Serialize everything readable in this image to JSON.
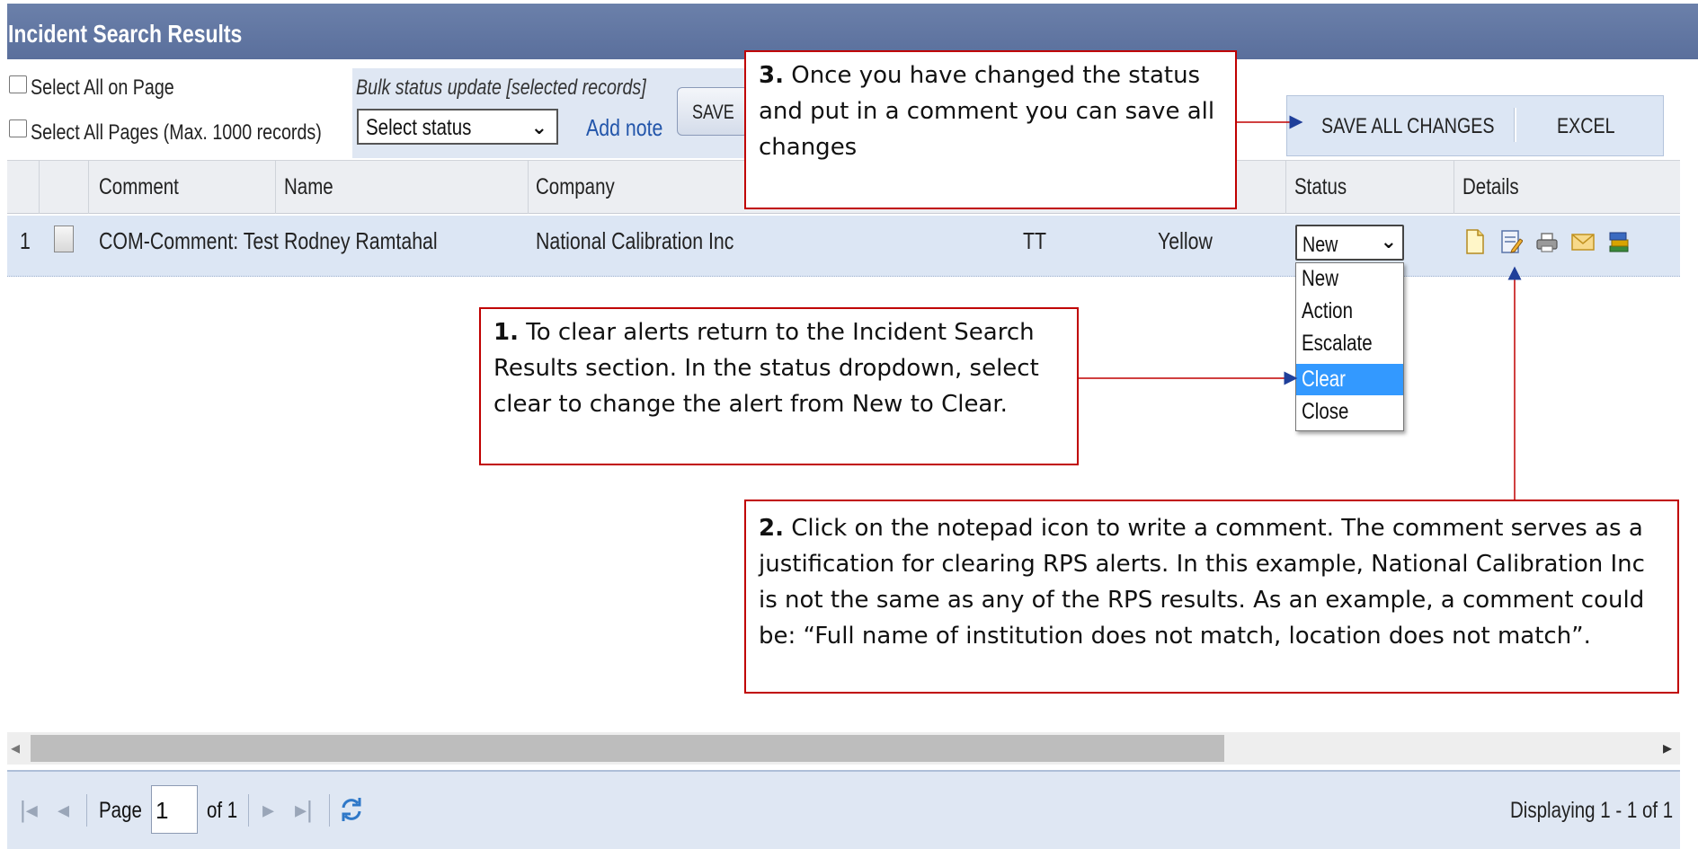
{
  "panel": {
    "title": "Incident Search Results"
  },
  "toolbar": {
    "select_all_page": "Select All on Page",
    "select_all_pages": "Select All Pages (Max. 1000 records)",
    "bulk_label": "Bulk status update [selected records]",
    "status_placeholder": "Select status",
    "add_note": "Add note",
    "save": "SAVE",
    "save_all": "SAVE ALL CHANGES",
    "excel": "EXCEL"
  },
  "grid": {
    "headers": [
      "Comment",
      "Name",
      "Company",
      "Status",
      "Details"
    ],
    "rows": [
      {
        "index": "1",
        "comment": "COM-Comment: Test",
        "name": "Rodney Ramtahal",
        "company": "National Calibration Inc",
        "country": "TT",
        "risk": "Yellow",
        "status": "New"
      }
    ]
  },
  "status_dropdown": {
    "options": [
      "New",
      "Action",
      "Escalate",
      "Clear",
      "Close"
    ],
    "highlighted": "Clear"
  },
  "details_icons": [
    "document-icon",
    "notepad-icon",
    "print-icon",
    "mail-icon",
    "books-icon"
  ],
  "annotations": {
    "step1": {
      "num": "1.",
      "text": " To clear alerts return to the Incident Search Results section. In the status dropdown, select clear to change the alert from New to Clear."
    },
    "step2": {
      "num": "2.",
      "text": " Click on the notepad icon to write a comment. The comment serves as a justification for clearing RPS alerts. In this example, National Calibration Inc is not the same as any of the RPS results. As an example, a comment could be: “Full name of institution does not match, location does not match”."
    },
    "step3": {
      "num": "3.",
      "text": " Once you have changed the status and put in a comment you can save all changes"
    }
  },
  "pager": {
    "page_label": "Page",
    "page_value": "1",
    "of_label": "of 1",
    "displaying": "Displaying 1 - 1 of 1"
  },
  "colors": {
    "header": "#5a6f9c",
    "row": "#dce6f4",
    "highlight": "#3399ff",
    "annotation_border": "#c00000"
  }
}
